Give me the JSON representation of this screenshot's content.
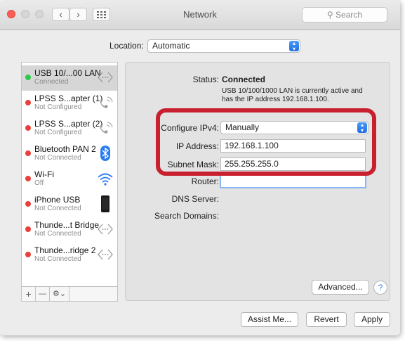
{
  "window": {
    "title": "Network",
    "search_placeholder": "Search",
    "nav_back": "‹",
    "nav_forward": "›",
    "grid_icon": "grid-icon",
    "traffic_lights": {
      "close": "#fc5f57",
      "minimize": "#d9d9d9",
      "zoom": "#d9d9d9"
    }
  },
  "location": {
    "label": "Location:",
    "value": "Automatic"
  },
  "services": [
    {
      "name": "USB 10/...00 LAN",
      "status": "Connected",
      "dot": "#2fc84a",
      "icon": "ethernet-icon",
      "selected": true
    },
    {
      "name": "LPSS S...apter (1)",
      "status": "Not Configured",
      "dot": "#e8403a",
      "icon": "phone-icon"
    },
    {
      "name": "LPSS S...apter (2)",
      "status": "Not Configured",
      "dot": "#e8403a",
      "icon": "phone-icon"
    },
    {
      "name": "Bluetooth PAN 2",
      "status": "Not Connected",
      "dot": "#e8403a",
      "icon": "bluetooth-icon"
    },
    {
      "name": "Wi-Fi",
      "status": "Off",
      "dot": "#e8403a",
      "icon": "wifi-icon"
    },
    {
      "name": "iPhone USB",
      "status": "Not Connected",
      "dot": "#e8403a",
      "icon": "iphone-icon"
    },
    {
      "name": "Thunde...t Bridge",
      "status": "Not Connected",
      "dot": "#e8403a",
      "icon": "ethernet-icon"
    },
    {
      "name": "Thunde...ridge 2",
      "status": "Not Connected",
      "dot": "#e8403a",
      "icon": "ethernet-icon"
    }
  ],
  "sidebar_buttons": {
    "add": "+",
    "remove": "—",
    "action": "⚙⌄"
  },
  "detail": {
    "status_label": "Status:",
    "status_value": "Connected",
    "status_desc_1": "USB 10/100/1000 LAN is currently active and",
    "status_desc_2": "has the IP address 192.168.1.100.",
    "configure_label": "Configure IPv4:",
    "configure_value": "Manually",
    "ip_label": "IP Address:",
    "ip_value": "192.168.1.100",
    "mask_label": "Subnet Mask:",
    "mask_value": "255.255.255.0",
    "router_label": "Router:",
    "router_value": "",
    "dns_label": "DNS Server:",
    "domains_label": "Search Domains:",
    "advanced_label": "Advanced...",
    "help_label": "?"
  },
  "footer": {
    "assist": "Assist Me...",
    "revert": "Revert",
    "apply": "Apply"
  },
  "annotation_color": "#c8202f"
}
